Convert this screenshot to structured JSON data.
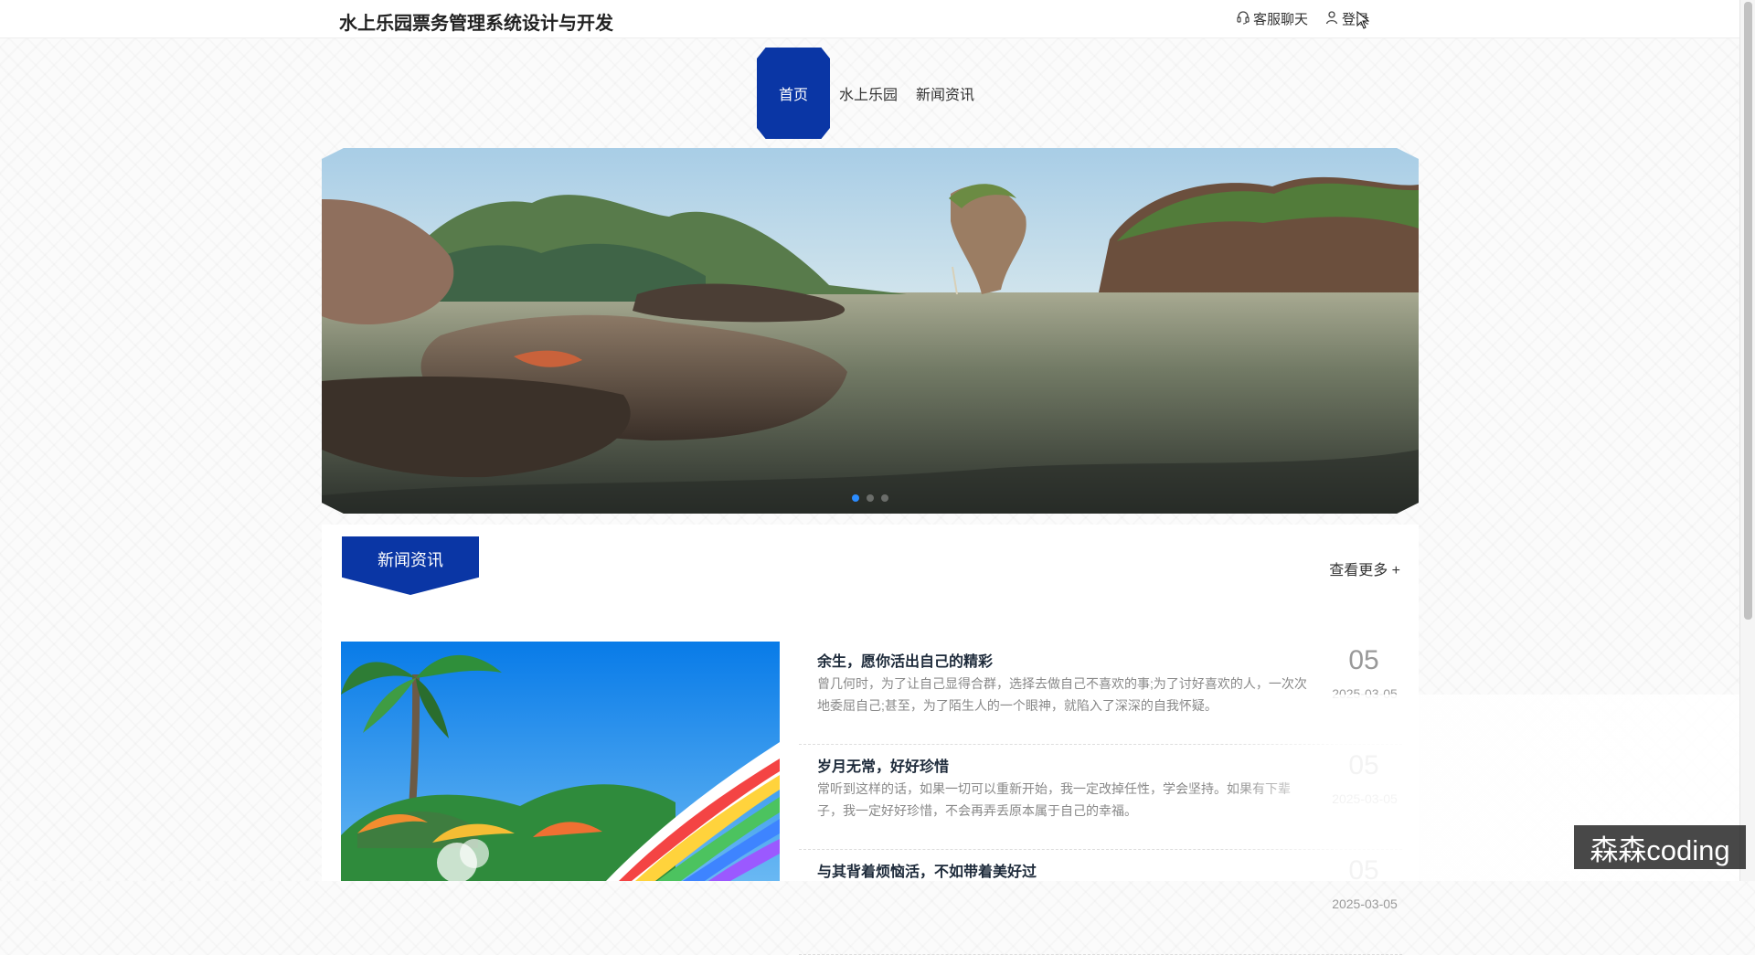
{
  "header": {
    "site_title": "水上乐园票务管理系统设计与开发",
    "chat_label": "客服聊天",
    "login_label": "登录"
  },
  "nav": {
    "items": [
      {
        "label": "首页",
        "active": true
      },
      {
        "label": "水上乐园",
        "active": false
      },
      {
        "label": "新闻资讯",
        "active": false
      }
    ]
  },
  "banner": {
    "current_slide": 1,
    "slide_count": 3
  },
  "news_section": {
    "title": "新闻资讯",
    "more_label": "查看更多 +",
    "items": [
      {
        "title": "余生，愿你活出自己的精彩",
        "summary": "曾几何时，为了让自己显得合群，选择去做自己不喜欢的事;为了讨好喜欢的人，一次次地委屈自己;甚至，为了陌生人的一个眼神，就陷入了深深的自我怀疑。",
        "day": "05",
        "date": "2025-03-05"
      },
      {
        "title": "岁月无常，好好珍惜",
        "summary": "常听到这样的话，如果一切可以重新开始，我一定改掉任性，学会坚持。如果有下辈子，我一定好好珍惜，不会再弄丢原本属于自己的幸福。",
        "day": "05",
        "date": "2025-03-05"
      },
      {
        "title": "与其背着烦恼活，不如带着美好过",
        "summary": "",
        "day": "05",
        "date": "2025-03-05"
      }
    ]
  },
  "watermark": {
    "text": "森森coding"
  },
  "colors": {
    "accent": "#0a36a5",
    "active_dot": "#2b8cff"
  },
  "icons": {
    "chat": "headset-icon",
    "login": "user-icon",
    "pointer": "mouse-pointer-icon"
  }
}
